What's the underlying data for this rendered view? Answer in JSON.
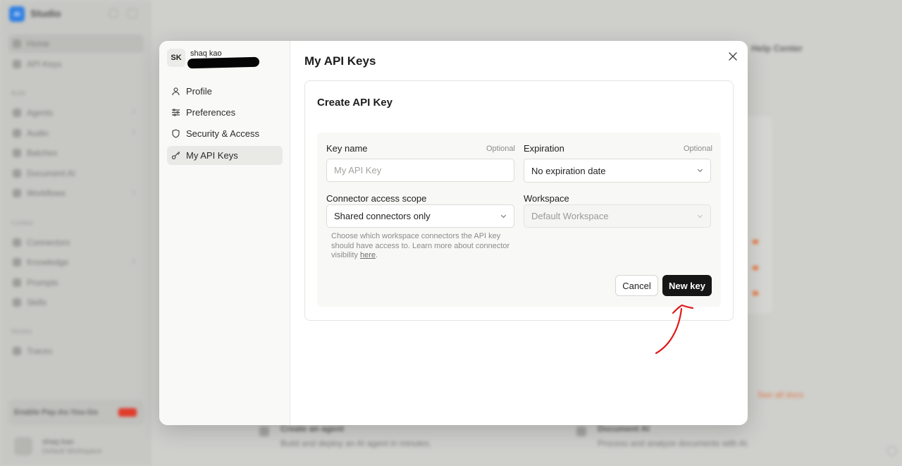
{
  "background": {
    "brand": "Studio",
    "nav_primary": [
      "Home",
      "API Keys"
    ],
    "section_build": "Build",
    "nav_build": [
      "Agents",
      "Audio",
      "Batches",
      "Document AI",
      "Workflows"
    ],
    "section_context": "Context",
    "nav_context": [
      "Connectors",
      "Knowledge",
      "Prompts",
      "Skills"
    ],
    "section_monitor": "Monitor",
    "nav_monitor": [
      "Traces"
    ],
    "upgrade_label": "Enable Pay-As-You-Go",
    "user_name": "shaq kao",
    "user_workspace": "Default Workspace",
    "help_center": "Help Center",
    "see_all": "See all docs",
    "feature_agent_title": "Create an agent",
    "feature_agent_desc": "Build and deploy an AI agent in minutes.",
    "feature_doc_title": "Document AI",
    "feature_doc_desc": "Process and analyze documents with AI."
  },
  "modal": {
    "user": {
      "initials": "SK",
      "name": "shaq kao"
    },
    "nav": [
      {
        "label": "Profile",
        "icon": "user-icon"
      },
      {
        "label": "Preferences",
        "icon": "sliders-icon"
      },
      {
        "label": "Security & Access",
        "icon": "shield-icon"
      },
      {
        "label": "My API Keys",
        "icon": "key-icon",
        "active": true
      }
    ],
    "title": "My API Keys",
    "card_title": "Create API Key",
    "form": {
      "key_name_label": "Key name",
      "key_name_optional": "Optional",
      "key_name_placeholder": "My API Key",
      "key_name_value": "",
      "expiration_label": "Expiration",
      "expiration_optional": "Optional",
      "expiration_value": "No expiration date",
      "scope_label": "Connector access scope",
      "scope_value": "Shared connectors only",
      "workspace_label": "Workspace",
      "workspace_value": "Default Workspace",
      "hint_text": "Choose which workspace connectors the API key should have access to. Learn more about connector visibility ",
      "hint_link": "here",
      "hint_end": "."
    },
    "cancel_label": "Cancel",
    "submit_label": "New key"
  },
  "colors": {
    "primary_button": "#161616",
    "annotation_arrow": "#e01a1a",
    "backdrop": "#cfcfcd"
  }
}
